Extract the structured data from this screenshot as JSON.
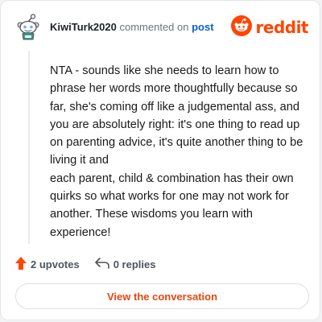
{
  "header": {
    "username": "KiwiTurk2020",
    "action_text": "commented on",
    "post_link": "post",
    "brand": "reddit",
    "avatar_icon": "snoo-avatar-icon",
    "brand_icon": "reddit-logo-icon"
  },
  "comment": {
    "lines": [
      "NTA - sounds like she needs to learn how to phrase her words more thoughtfully because so far, she's coming off like a judgemental ass, and you are absolutely right: it's one thing to read up on parenting advice, it's quite another thing to be living it and",
      "each parent, child & combination has their own quirks so what works for one may not work for another. These wisdoms you learn with experience!"
    ]
  },
  "footer": {
    "upvotes": "2 upvotes",
    "replies": "0 replies",
    "upvote_icon": "upvote-arrow-icon",
    "reply_icon": "reply-icon"
  },
  "cta": {
    "label": "View the conversation"
  },
  "colors": {
    "accent": "#ff4500",
    "link": "#0b5fd0",
    "cta_text": "#e5470f"
  }
}
